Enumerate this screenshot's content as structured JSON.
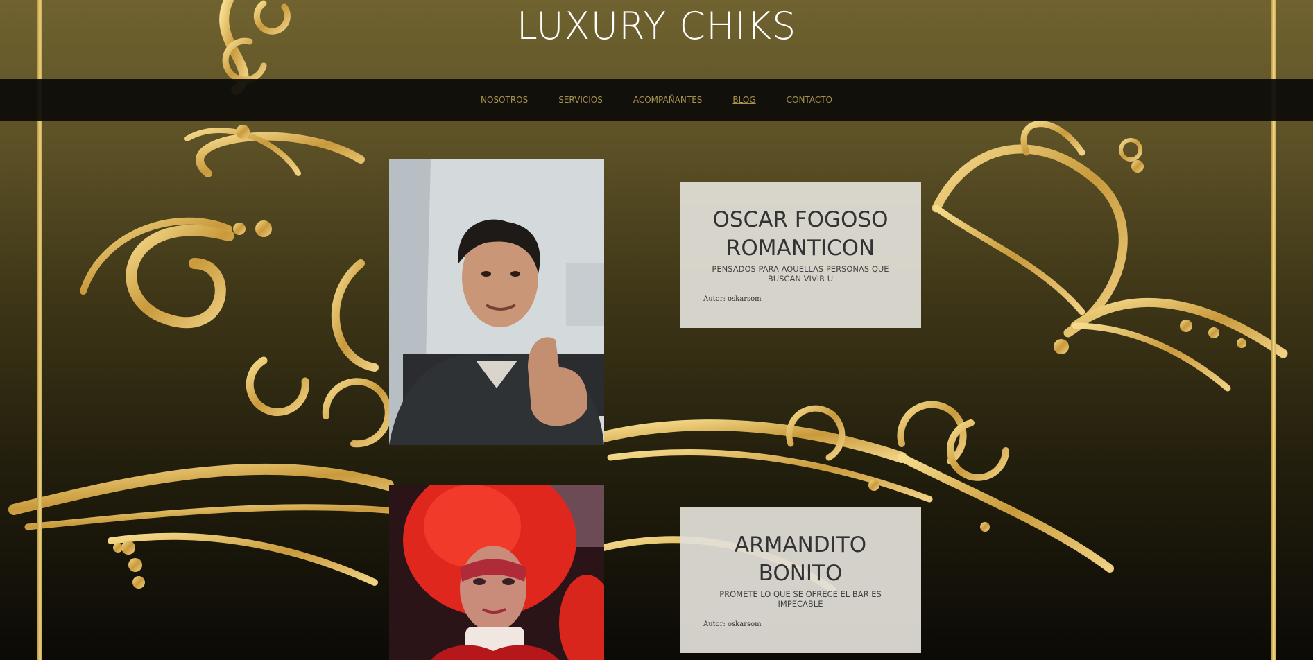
{
  "header": {
    "site_title": "LUXURY CHIKS"
  },
  "nav": {
    "items": [
      {
        "label": "NOSOTROS",
        "active": false
      },
      {
        "label": "SERVICIOS",
        "active": false
      },
      {
        "label": "ACOMPAÑANTES",
        "active": false
      },
      {
        "label": "BLOG",
        "active": true
      },
      {
        "label": "CONTACTO",
        "active": false
      }
    ]
  },
  "posts": [
    {
      "title": "OSCAR FOGOSO ROMANTICON",
      "excerpt": "PENSADOS PARA AQUELLAS PERSONAS QUE BUSCAN VIVIR U",
      "author": "Autor: oskarsom"
    },
    {
      "title": "ARMANDITO BONITO",
      "excerpt": "PROMETE LO QUE SE OFRECE EL BAR ES IMPECABLE",
      "author": "Autor: oskarsom"
    }
  ],
  "colors": {
    "gold": "#d9b45a",
    "nav_link": "#a8924f",
    "card_bg": "#e2e0d8"
  }
}
